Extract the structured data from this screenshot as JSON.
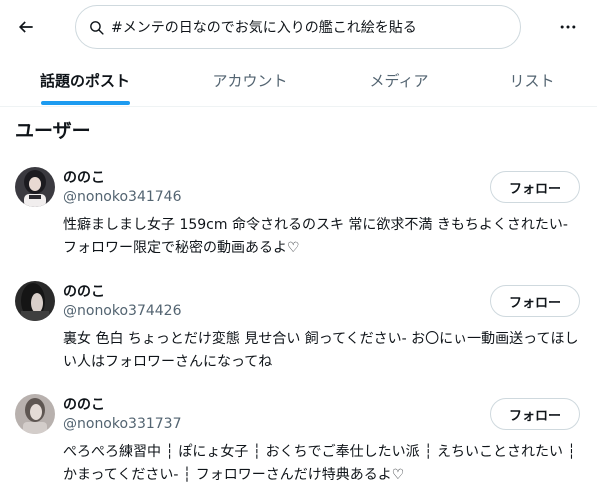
{
  "search": {
    "query": "#メンテの日なのでお気に入りの艦これ絵を貼る"
  },
  "tabs": [
    {
      "label": "話題のポスト",
      "active": true
    },
    {
      "label": "アカウント",
      "active": false
    },
    {
      "label": "メディア",
      "active": false
    },
    {
      "label": "リスト",
      "active": false
    }
  ],
  "section_title": "ユーザー",
  "users": [
    {
      "name": "ののこ",
      "handle": "@nonoko341746",
      "follow_label": "フォロー",
      "bio": "性癖ましまし女子 159cm 命令されるのスキ 常に欲求不満 きもちよくされたい- フォロワー限定で秘密の動画あるよ♡"
    },
    {
      "name": "ののこ",
      "handle": "@nonoko374426",
      "follow_label": "フォロー",
      "bio": "裏女 色白 ちょっとだけ変態 見せ合い 飼ってください- お〇にぃ一動画送ってほしい人はフォロワーさんになってね"
    },
    {
      "name": "ののこ",
      "handle": "@nonoko331737",
      "follow_label": "フォロー",
      "bio": "ぺろぺろ練習中 ┆ ぽにょ女子 ┆ おくちでご奉仕したい派 ┆ えちいことされたい ┆ かまってください- ┆ フォロワーさんだけ特典あるよ♡"
    }
  ],
  "colors": {
    "accent": "#1d9bf0",
    "text": "#0f1419",
    "muted": "#536471",
    "border": "#cfd9de"
  },
  "icons": {
    "back": "arrow-left-icon",
    "search": "search-icon",
    "more": "more-horizontal-icon"
  }
}
